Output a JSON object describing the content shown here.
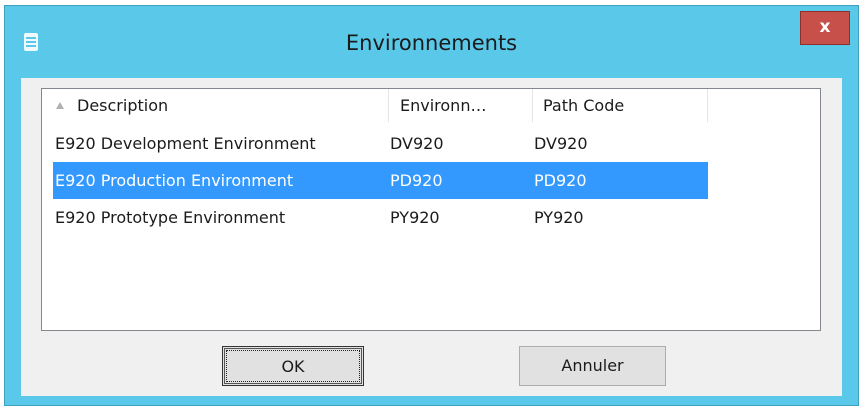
{
  "window": {
    "title": "Environnements",
    "close_label": "x",
    "icon": "list-icon"
  },
  "list": {
    "columns": [
      {
        "label": "Description",
        "sorted": "ascending"
      },
      {
        "label": "Environn…"
      },
      {
        "label": "Path Code"
      }
    ],
    "rows": [
      {
        "description": "E920 Development Environment",
        "environment": "DV920",
        "path_code": "DV920",
        "selected": false
      },
      {
        "description": "E920 Production Environment",
        "environment": "PD920",
        "path_code": "PD920",
        "selected": true
      },
      {
        "description": "E920 Prototype Environment",
        "environment": "PY920",
        "path_code": "PY920",
        "selected": false
      }
    ]
  },
  "buttons": {
    "ok_label": "OK",
    "cancel_label": "Annuler"
  },
  "colors": {
    "titlebar": "#5ac8e8",
    "close_button": "#c7504a",
    "selection": "#3399ff"
  }
}
